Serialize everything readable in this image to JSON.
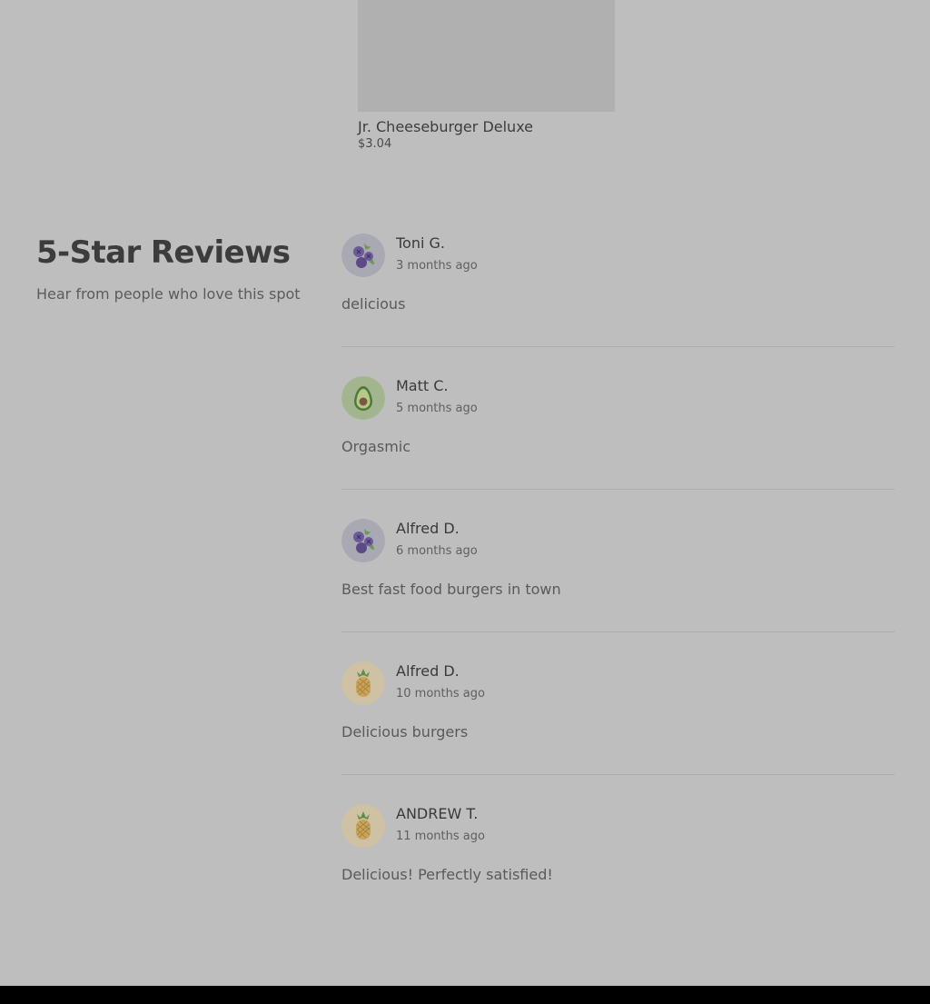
{
  "product": {
    "name": "Jr. Cheeseburger Deluxe",
    "price": "$3.04"
  },
  "reviews_section": {
    "title": "5-Star Reviews",
    "subtitle": "Hear from people who love this spot"
  },
  "reviews": [
    {
      "name": "Toni G.",
      "date": "3 months ago",
      "text": "delicious",
      "avatar": "blueberry-icon"
    },
    {
      "name": "Matt C.",
      "date": "5 months ago",
      "text": "Orgasmic",
      "avatar": "avocado-icon"
    },
    {
      "name": "Alfred D.",
      "date": "6 months ago",
      "text": "Best fast food burgers in town",
      "avatar": "blueberry-icon"
    },
    {
      "name": "Alfred D.",
      "date": "10 months ago",
      "text": "Delicious burgers",
      "avatar": "pineapple-icon"
    },
    {
      "name": "ANDREW T.",
      "date": "11 months ago",
      "text": "Delicious! Perfectly satisfied!",
      "avatar": "pineapple-icon"
    }
  ],
  "colors": {
    "overlay_background": "#bebebe",
    "avatar_blueberry_bg": "#a9a9b3",
    "avatar_avocado_bg": "#a3b58f",
    "avatar_pineapple_bg": "#cfc1a3"
  }
}
